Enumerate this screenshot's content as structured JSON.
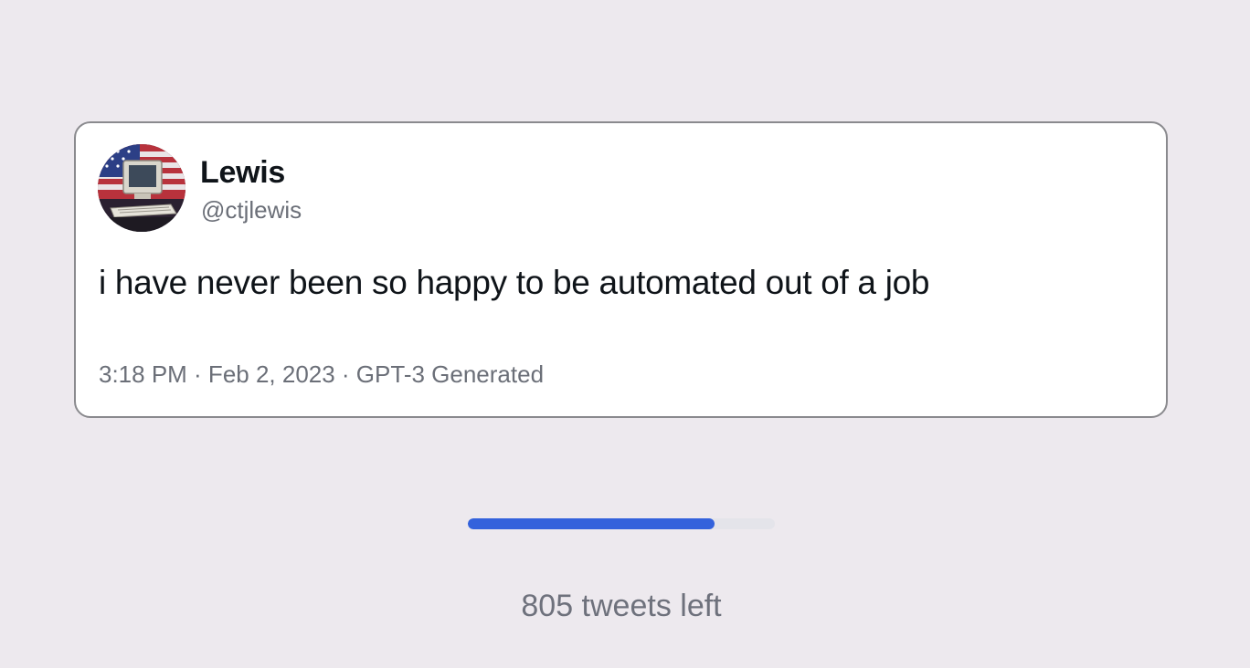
{
  "tweet": {
    "author_name": "Lewis",
    "author_handle": "@ctjlewis",
    "avatar_icon": "retro-computer-flag-avatar",
    "text": "i have never been so happy to be automated out of a job",
    "meta": "3:18 PM · Feb 2, 2023 · GPT-3 Generated"
  },
  "progress": {
    "fraction": 0.805,
    "fill_color": "#3462dc",
    "track_color": "#e4e4ea",
    "label": "805 tweets left"
  }
}
